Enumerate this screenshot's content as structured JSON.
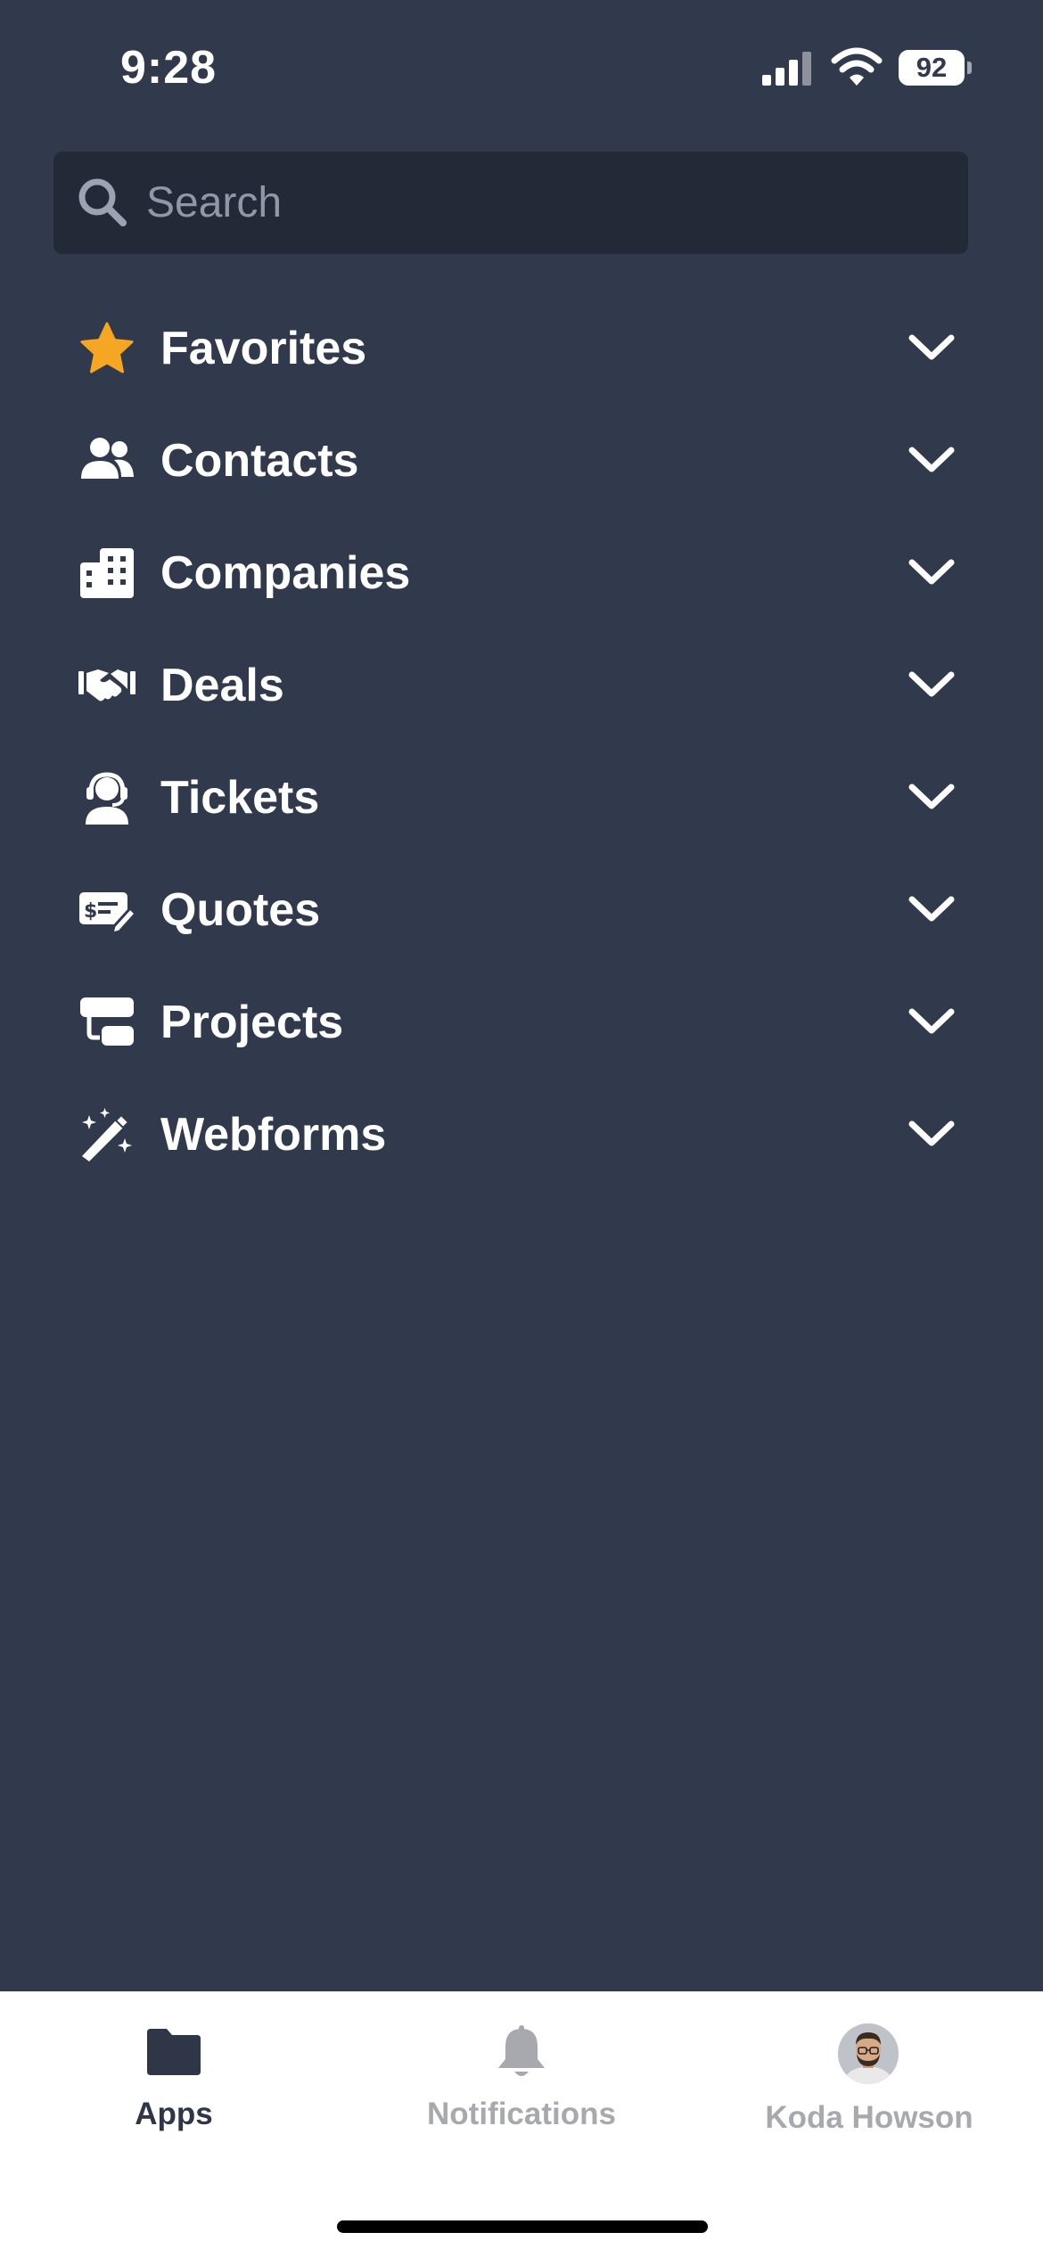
{
  "status_bar": {
    "time": "9:28",
    "battery": "92"
  },
  "search": {
    "placeholder": "Search"
  },
  "menu": [
    {
      "label": "Favorites",
      "icon": "star-icon"
    },
    {
      "label": "Contacts",
      "icon": "people-icon"
    },
    {
      "label": "Companies",
      "icon": "building-icon"
    },
    {
      "label": "Deals",
      "icon": "handshake-icon"
    },
    {
      "label": "Tickets",
      "icon": "headset-icon"
    },
    {
      "label": "Quotes",
      "icon": "quote-icon"
    },
    {
      "label": "Projects",
      "icon": "projects-icon"
    },
    {
      "label": "Webforms",
      "icon": "magic-wand-icon"
    }
  ],
  "tabs": {
    "apps": "Apps",
    "notifications": "Notifications",
    "profile": "Koda Howson"
  },
  "colors": {
    "background": "#313a4c",
    "search_bg": "#222937",
    "star": "#f5a623",
    "tab_active": "#2e3648",
    "tab_inactive": "#a7a9ae"
  }
}
